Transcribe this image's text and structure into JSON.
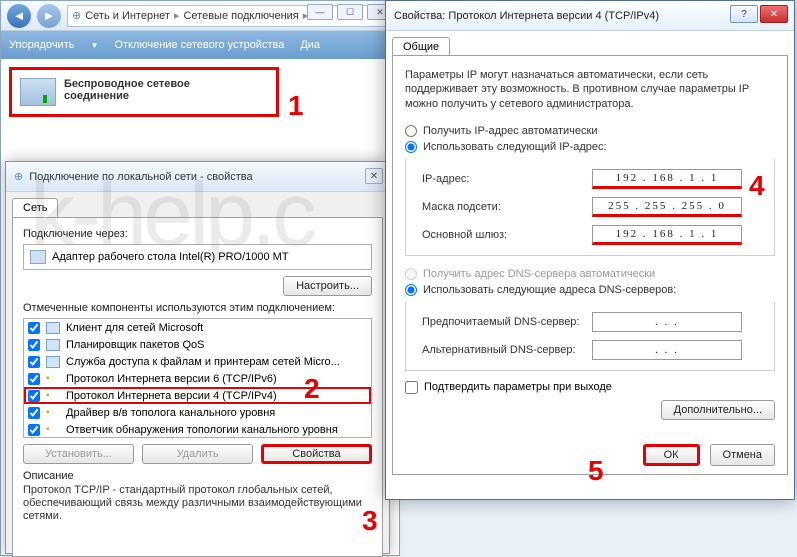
{
  "explorer": {
    "breadcrumb": {
      "part1": "Сеть и Интернет",
      "part2": "Сетевые подключения"
    },
    "toolbar": {
      "organize": "Упорядочить",
      "disable": "Отключение сетевого устройства",
      "diag": "Диа"
    },
    "wireless": {
      "line1": "Беспроводное сетевое",
      "line2": "соединение"
    }
  },
  "lan": {
    "title": "Подключение по локальной сети - свойства",
    "tab": "Сеть",
    "connect_via": "Подключение через:",
    "adapter": "Адаптер рабочего стола Intel(R) PRO/1000 MT",
    "configure": "Настроить...",
    "components_label": "Отмеченные компоненты используются этим подключением:",
    "components": [
      "Клиент для сетей Microsoft",
      "Планировщик пакетов QoS",
      "Служба доступа к файлам и принтерам сетей Micro...",
      "Протокол Интернета версии 6 (TCP/IPv6)",
      "Протокол Интернета версии 4 (TCP/IPv4)",
      "Драйвер в/в тополога канального уровня",
      "Ответчик обнаружения топологии канального уровня"
    ],
    "install": "Установить...",
    "remove": "Удалить",
    "properties": "Свойства",
    "desc_heading": "Описание",
    "desc_body": "Протокол TCP/IP - стандартный протокол глобальных сетей, обеспечивающий связь между различными взаимодействующими сетями."
  },
  "ipv4": {
    "title": "Свойства: Протокол Интернета версии 4 (TCP/IPv4)",
    "tab": "Общие",
    "intro": "Параметры IP могут назначаться автоматически, если сеть поддерживает эту возможность. В противном случае параметры IP можно получить у сетевого администратора.",
    "radio_auto_ip": "Получить IP-адрес автоматически",
    "radio_manual_ip": "Использовать следующий IP-адрес:",
    "ip_label": "IP-адрес:",
    "ip_value": "192 . 168 .  1  .  1",
    "mask_label": "Маска подсети:",
    "mask_value": "255 . 255 . 255 .  0",
    "gw_label": "Основной шлюз:",
    "gw_value": "192 . 168 .  1  .  1",
    "radio_auto_dns": "Получить адрес DNS-сервера автоматически",
    "radio_manual_dns": "Использовать следующие адреса DNS-серверов:",
    "dns1_label": "Предпочитаемый DNS-сервер:",
    "dns1_value": " .       .       . ",
    "dns2_label": "Альтернативный DNS-сервер:",
    "dns2_value": " .       .       . ",
    "confirm": "Подтвердить параметры при выходе",
    "advanced": "Дополнительно...",
    "ok": "ОК",
    "cancel": "Отмена"
  },
  "steps": {
    "1": "1",
    "2": "2",
    "3": "3",
    "4": "4",
    "5": "5"
  },
  "watermark": "k-help.c"
}
